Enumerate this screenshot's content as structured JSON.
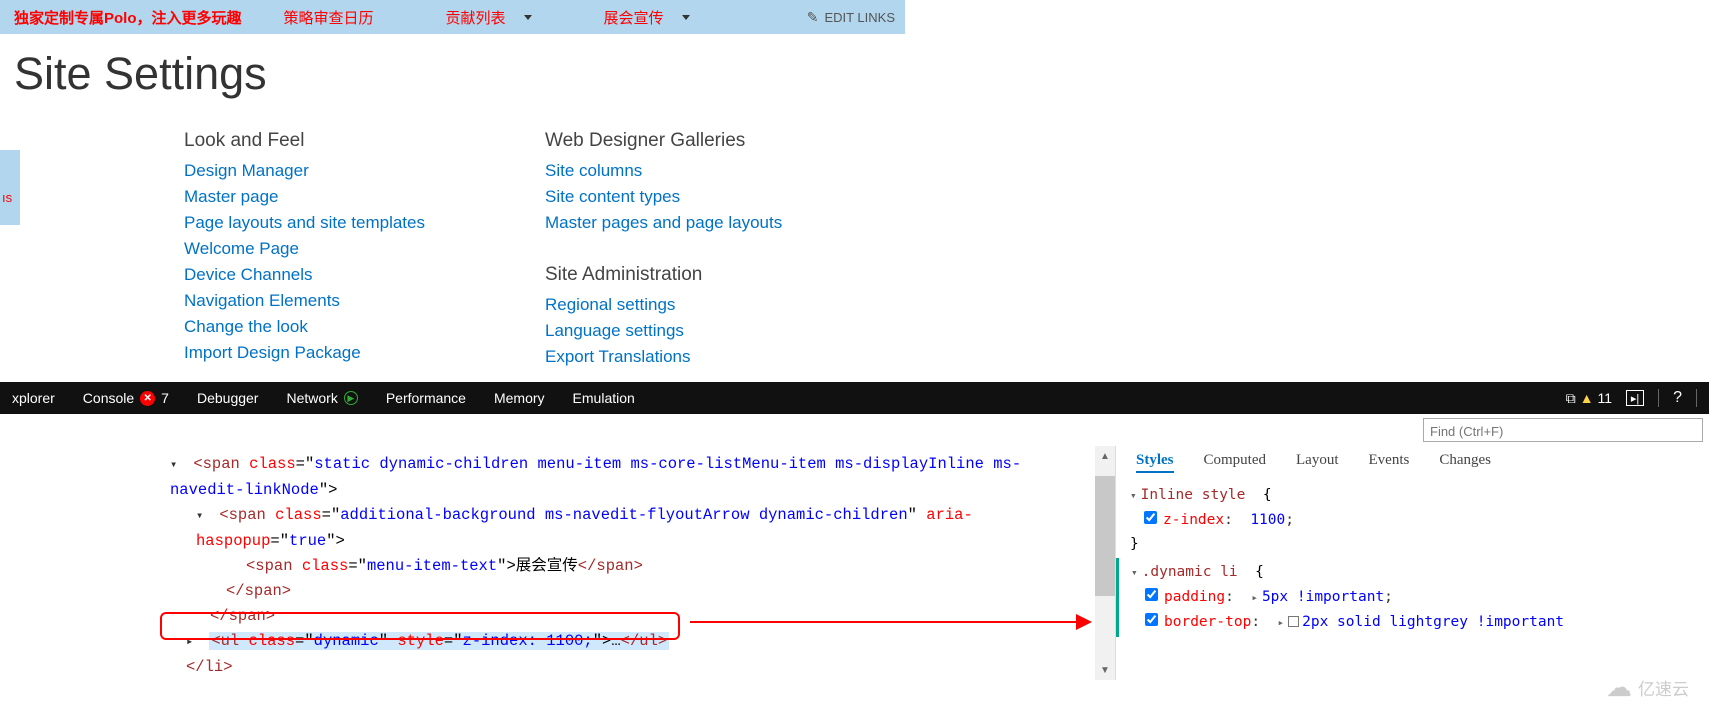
{
  "topnav": {
    "promo": "独家定制专属Polo，注入更多玩趣",
    "items": [
      "策略审查日历",
      "贡献列表",
      "展会宣传"
    ],
    "edit_links": "EDIT LINKS"
  },
  "left_fragment": "ıs",
  "page_title": "Site Settings",
  "columns": {
    "look_and_feel": {
      "heading": "Look and Feel",
      "links": [
        "Design Manager",
        "Master page",
        "Page layouts and site templates",
        "Welcome Page",
        "Device Channels",
        "Navigation Elements",
        "Change the look",
        "Import Design Package"
      ]
    },
    "wdg": {
      "heading": "Web Designer Galleries",
      "links": [
        "Site columns",
        "Site content types",
        "Master pages and page layouts"
      ]
    },
    "site_admin": {
      "heading": "Site Administration",
      "links": [
        "Regional settings",
        "Language settings",
        "Export Translations"
      ]
    }
  },
  "devtools": {
    "tabs": {
      "explorer": "xplorer",
      "console": "Console",
      "console_errors": "7",
      "debugger": "Debugger",
      "network": "Network",
      "performance": "Performance",
      "memory": "Memory",
      "emulation": "Emulation"
    },
    "warn_count": "11",
    "help": "?",
    "find_placeholder": "Find (Ctrl+F)"
  },
  "dom": {
    "line1_open": "<span ",
    "line1_cls": "class",
    "line1_eq": "=\"",
    "line1_val": "static dynamic-children menu-item ms-core-listMenu-item ms-displayInline ms-navedit-linkNode",
    "line1_close": "\">",
    "line2_open": "<span ",
    "line2_cls": "class",
    "line2_eq": "=\"",
    "line2_val": "additional-background ms-navedit-flyoutArrow dynamic-children",
    "line2_mid": "\" ",
    "line2_aria": "aria-haspopup",
    "line2_eq2": "=\"",
    "line2_ariaval": "true",
    "line2_close": "\">",
    "line3_open": "<span ",
    "line3_cls": "class",
    "line3_eq": "=\"",
    "line3_val": "menu-item-text",
    "line3_mid": "\">",
    "line3_text": "展会宣传",
    "line3_close": "</span>",
    "line4": "</span>",
    "line5": "</span>",
    "line6_open": "<ul ",
    "line6_cls": "class",
    "line6_eq": "=\"",
    "line6_val": "dynamic",
    "line6_mid": "\" ",
    "line6_sty": "style",
    "line6_eq2": "=\"",
    "line6_styval": "z-index: 1100;",
    "line6_mid2": "\">",
    "line6_ell": "…",
    "line6_close": "</ul>",
    "line7": "</li>"
  },
  "styles": {
    "tabs": [
      "Styles",
      "Computed",
      "Layout",
      "Events",
      "Changes"
    ],
    "inline_label": "Inline style",
    "zindex_prop": "z-index",
    "zindex_val": "1100",
    "dynamic_sel": ".dynamic li",
    "padding_prop": "padding",
    "padding_val": "5px !important",
    "bordertop_prop": "border-top",
    "bordertop_val": "2px solid lightgrey !important"
  },
  "watermark": "亿速云"
}
